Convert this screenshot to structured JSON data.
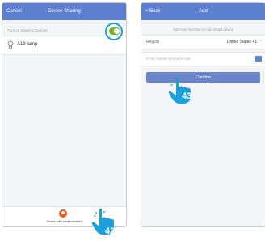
{
  "left_screen": {
    "nav": {
      "back": "Cancel",
      "title": "Device Sharing"
    },
    "hint": "Turn on Sharing Devices",
    "device": {
      "name": "A19 lamp",
      "toggle_on": true
    },
    "share_button": {
      "label": "Share with new member"
    }
  },
  "right_screen": {
    "nav": {
      "back": "< Back",
      "title": "Add"
    },
    "hint": "Add new member to use smart device",
    "region": {
      "label": "Region",
      "value": "United States +1"
    },
    "input": {
      "placeholder": "Enter mobile number/e-mail"
    },
    "confirm_label": "Confirm"
  },
  "steps": {
    "left": "42",
    "right": "43"
  },
  "colors": {
    "nav_blue": "#5c7fcf",
    "toggle_green": "#7ab32e",
    "highlight_ring": "#1aa0dc",
    "hand_blue": "#1aa0dc",
    "share_orange": "#e85a1e"
  }
}
